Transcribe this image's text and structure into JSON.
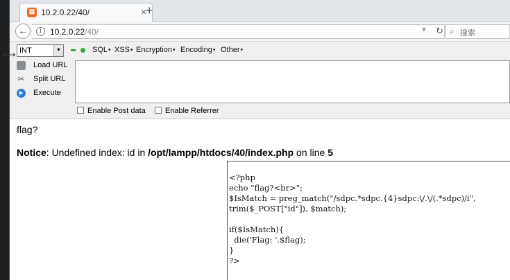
{
  "browser": {
    "tab": {
      "title": "10.2.0.22/40/",
      "close": "×"
    },
    "new_tab": "+",
    "address": {
      "host": "10.2.0.22",
      "path": "/40/"
    },
    "search_placeholder": "搜索"
  },
  "hackbar": {
    "select_value": "INT",
    "menus": [
      "SQL",
      "XSS",
      "Encryption",
      "Encoding",
      "Other"
    ],
    "actions": {
      "load": "Load URL",
      "split": "Split URL",
      "execute": "Execute"
    },
    "options": {
      "post": "Enable Post data",
      "referrer": "Enable Referrer"
    }
  },
  "page": {
    "flag_text": "flag?",
    "notice": {
      "label": "Notice",
      "message": ": Undefined index: id in ",
      "path": "/opt/lampp/htdocs/40/index.php",
      "on_line": " on line ",
      "line": "5"
    },
    "code_lines": [
      "<?php",
      "echo \"flag?<br>\";",
      "$IsMatch = preg_match(\"/sdpc.*sdpc.{4}sdpc:\\/.\\/(.*sdpc)/i\",",
      "trim($_POST[\"id\"]), $match);",
      "",
      "if($IsMatch){",
      "  die('Flag: '.$flag);",
      "}",
      "?>"
    ]
  }
}
